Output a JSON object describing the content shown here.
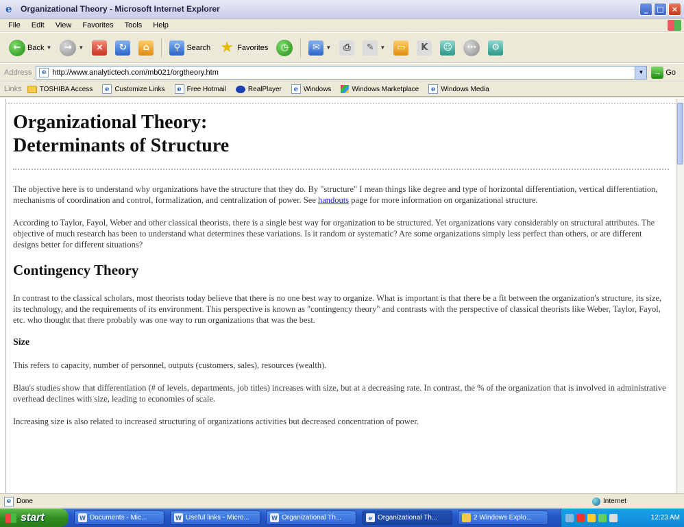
{
  "window": {
    "title": "Organizational Theory - Microsoft Internet Explorer"
  },
  "menu": [
    "File",
    "Edit",
    "View",
    "Favorites",
    "Tools",
    "Help"
  ],
  "toolbar": {
    "back_label": "Back",
    "search_label": "Search",
    "favorites_label": "Favorites"
  },
  "address": {
    "label": "Address",
    "url": "http://www.analytictech.com/mb021/orgtheory.htm",
    "go_label": "Go"
  },
  "links": {
    "label": "Links",
    "items": [
      "TOSHIBA Access",
      "Customize Links",
      "Free Hotmail",
      "RealPlayer",
      "Windows",
      "Windows Marketplace",
      "Windows Media"
    ]
  },
  "page": {
    "title_line1": "Organizational Theory:",
    "title_line2": "Determinants of Structure",
    "p1_before": "The objective here is to understand why organizations have the structure that they do. By \"structure\" I mean things like degree and type of horizontal differentiation, vertical differentiation, mechanisms of coordination and control, formalization, and centralization of power. See ",
    "p1_link": "handouts",
    "p1_after": " page for more information on organizational structure.",
    "p2": "According to Taylor, Fayol, Weber and other classical theorists, there is a single best way for organization to be structured. Yet organizations vary considerably on structural attributes. The objective of much research has been to understand what determines these variations. Is it random or systematic? Are some organizations simply less perfect than others, or are different designs better for different situations?",
    "h2_contingency": "Contingency Theory",
    "p3": "In contrast to the classical scholars, most theorists today believe that there is no one best way to organize. What is important is that there be a fit between the organization's structure, its size, its technology, and the requirements of its environment. This perspective is known as \"contingency theory\" and contrasts with the perspective of classical theorists like Weber, Taylor, Fayol, etc. who thought that there probably was one way to run organizations that was the best.",
    "h3_size": "Size",
    "p4": "This refers to capacity, number of personnel, outputs (customers, sales), resources (wealth).",
    "p5": "Blau's studies show that differentiation (# of levels, departments, job titles) increases with size, but at a decreasing rate. In contrast, the % of the organization that is involved in administrative overhead declines with size, leading to economies of scale.",
    "p6": "Increasing size is also related to increased structuring of organizations activities but decreased concentration of power."
  },
  "status": {
    "left": "Done",
    "zone": "Internet"
  },
  "taskbar": {
    "start_label": "start",
    "tasks": [
      "Documents - Mic...",
      "Useful links - Micro...",
      "Organizational Th...",
      "Organizational Th...",
      "2 Windows Explo..."
    ],
    "clock": "12:23 AM"
  }
}
